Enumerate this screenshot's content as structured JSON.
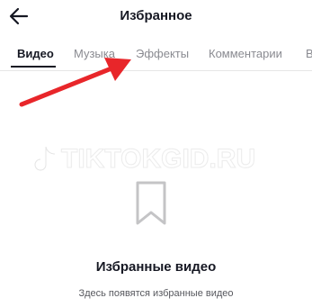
{
  "header": {
    "title": "Избранное",
    "back_icon": "arrow-left-icon"
  },
  "tabs": [
    {
      "label": "Видео",
      "active": true
    },
    {
      "label": "Музыка",
      "active": false
    },
    {
      "label": "Эффекты",
      "active": false
    },
    {
      "label": "Комментарии",
      "active": false
    },
    {
      "label": "В",
      "active": false
    }
  ],
  "annotation": {
    "arrow_color": "#e8262a",
    "icon": "red-arrow-icon"
  },
  "watermark": {
    "text": "TIKTOKGID.RU",
    "icon": "tiktok-logo-icon"
  },
  "empty_state": {
    "icon": "bookmark-icon",
    "title": "Избранные видео",
    "subtitle": "Здесь появятся избранные видео"
  }
}
